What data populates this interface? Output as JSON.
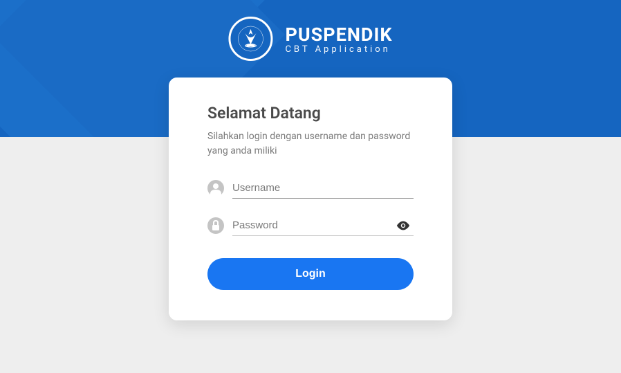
{
  "brand": {
    "title": "PUSPENDIK",
    "subtitle": "CBT Application"
  },
  "card": {
    "title": "Selamat Datang",
    "subtitle": "Silahkan login dengan username dan password yang anda miliki"
  },
  "form": {
    "username_placeholder": "Username",
    "username_value": "",
    "password_placeholder": "Password",
    "password_value": "",
    "login_label": "Login"
  }
}
